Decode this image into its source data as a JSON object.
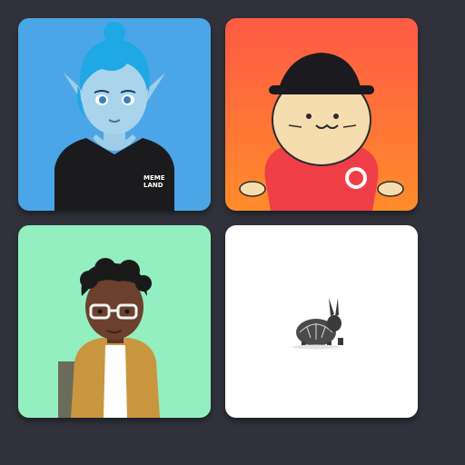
{
  "cards": [
    {
      "id": "blue-elf-girl",
      "background": "#4aa6e6",
      "accent": "#37b3e6",
      "shirt_text_line1": "MEME",
      "shirt_text_line2": "LAND"
    },
    {
      "id": "seal-with-hat",
      "background_top": "#ff5a45",
      "background_bottom": "#ff8c2a",
      "shirt_color": "#f03e46"
    },
    {
      "id": "boy-with-glasses",
      "background": "#93efc0",
      "jacket_color": "#c9953e"
    },
    {
      "id": "turtle-rabbit",
      "background": "#ffffff"
    }
  ]
}
